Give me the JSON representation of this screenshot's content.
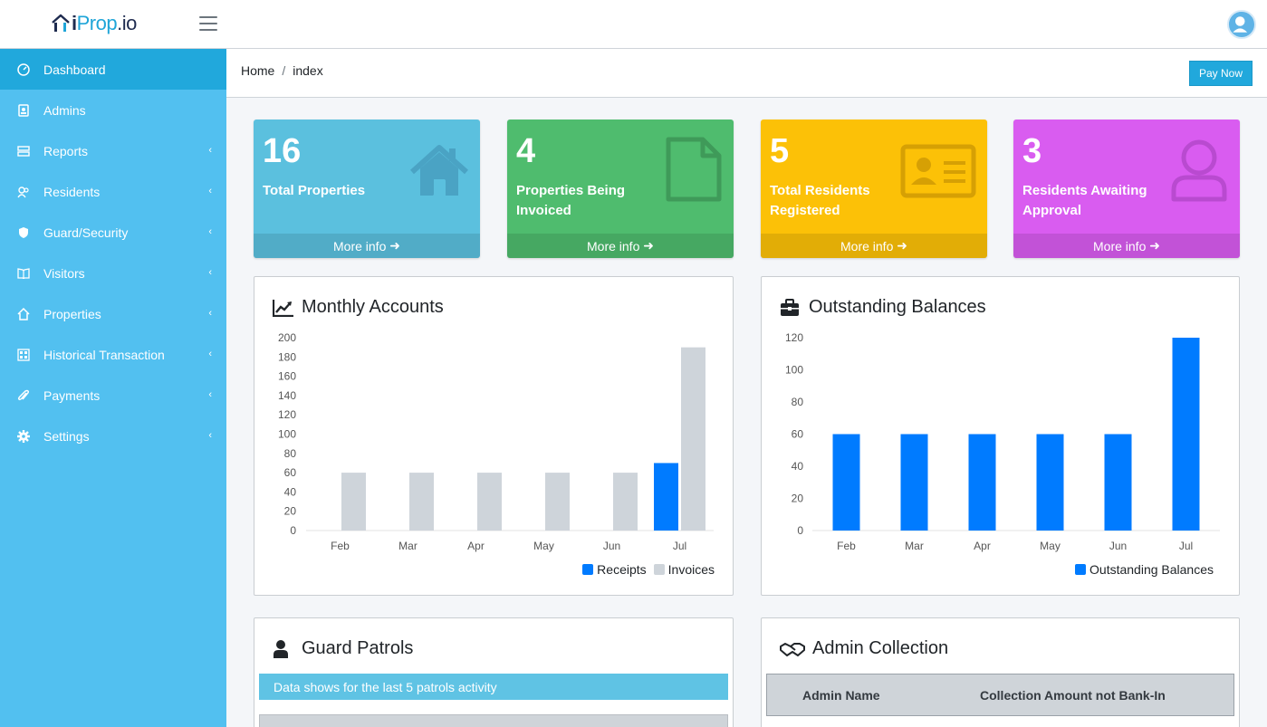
{
  "header": {
    "logo": {
      "part1": "i",
      "part2": "Prop",
      "part3": ".io"
    }
  },
  "sidebar": {
    "items": [
      {
        "label": "Dashboard",
        "icon": "dashboard-gauge-icon",
        "has_caret": false,
        "active": true
      },
      {
        "label": "Admins",
        "icon": "id-badge-icon",
        "has_caret": false
      },
      {
        "label": "Reports",
        "icon": "server-icon",
        "has_caret": true
      },
      {
        "label": "Residents",
        "icon": "users-icon",
        "has_caret": true
      },
      {
        "label": "Guard/Security",
        "icon": "shield-icon",
        "has_caret": true
      },
      {
        "label": "Visitors",
        "icon": "book-icon",
        "has_caret": true
      },
      {
        "label": "Properties",
        "icon": "home-icon",
        "has_caret": true
      },
      {
        "label": "Historical Transaction",
        "icon": "grid-icon",
        "has_caret": true
      },
      {
        "label": "Payments",
        "icon": "paperclip-icon",
        "has_caret": true
      },
      {
        "label": "Settings",
        "icon": "gear-icon",
        "has_caret": true
      }
    ]
  },
  "breadcrumb": {
    "home": "Home",
    "separator": "/",
    "current": "index"
  },
  "pay_now": "Pay Now",
  "stats": [
    {
      "value": "16",
      "label": "Total Properties",
      "more": "More info",
      "color": "#5bc0de",
      "icon": "house-icon"
    },
    {
      "value": "4",
      "label": "Properties Being Invoiced",
      "more": "More info",
      "color": "#4fbc6e",
      "icon": "file-icon"
    },
    {
      "value": "5",
      "label": "Total Residents Registered",
      "more": "More info",
      "color": "#fcc107",
      "icon": "id-card-icon"
    },
    {
      "value": "3",
      "label": "Residents Awaiting Approval",
      "more": "More info",
      "color": "#d95cf0",
      "icon": "user-icon"
    }
  ],
  "panels": {
    "monthly": {
      "title": "Monthly Accounts"
    },
    "outstanding": {
      "title": "Outstanding Balances"
    },
    "guard": {
      "title": "Guard Patrols",
      "info": "Data shows for the last 5 patrols activity"
    },
    "admin": {
      "title": "Admin Collection",
      "col1": "Admin Name",
      "col2": "Collection Amount not Bank-In"
    }
  },
  "chart_data": [
    {
      "type": "bar",
      "categories": [
        "Feb",
        "Mar",
        "Apr",
        "May",
        "Jun",
        "Jul"
      ],
      "series": [
        {
          "name": "Receipts",
          "values": [
            0,
            0,
            0,
            0,
            0,
            70
          ],
          "color": "#007bff"
        },
        {
          "name": "Invoices",
          "values": [
            60,
            60,
            60,
            60,
            60,
            190
          ],
          "color": "#ced4da"
        }
      ],
      "yticks": [
        0,
        20,
        40,
        60,
        80,
        100,
        120,
        140,
        160,
        180,
        200
      ],
      "ylim": [
        0,
        200
      ],
      "legend": "bottom-right"
    },
    {
      "type": "bar",
      "categories": [
        "Feb",
        "Mar",
        "Apr",
        "May",
        "Jun",
        "Jul"
      ],
      "series": [
        {
          "name": "Outstanding Balances",
          "values": [
            60,
            60,
            60,
            60,
            60,
            120
          ],
          "color": "#007bff"
        }
      ],
      "yticks": [
        0,
        20,
        40,
        60,
        80,
        100,
        120
      ],
      "ylim": [
        0,
        120
      ],
      "legend": "bottom-right"
    }
  ]
}
